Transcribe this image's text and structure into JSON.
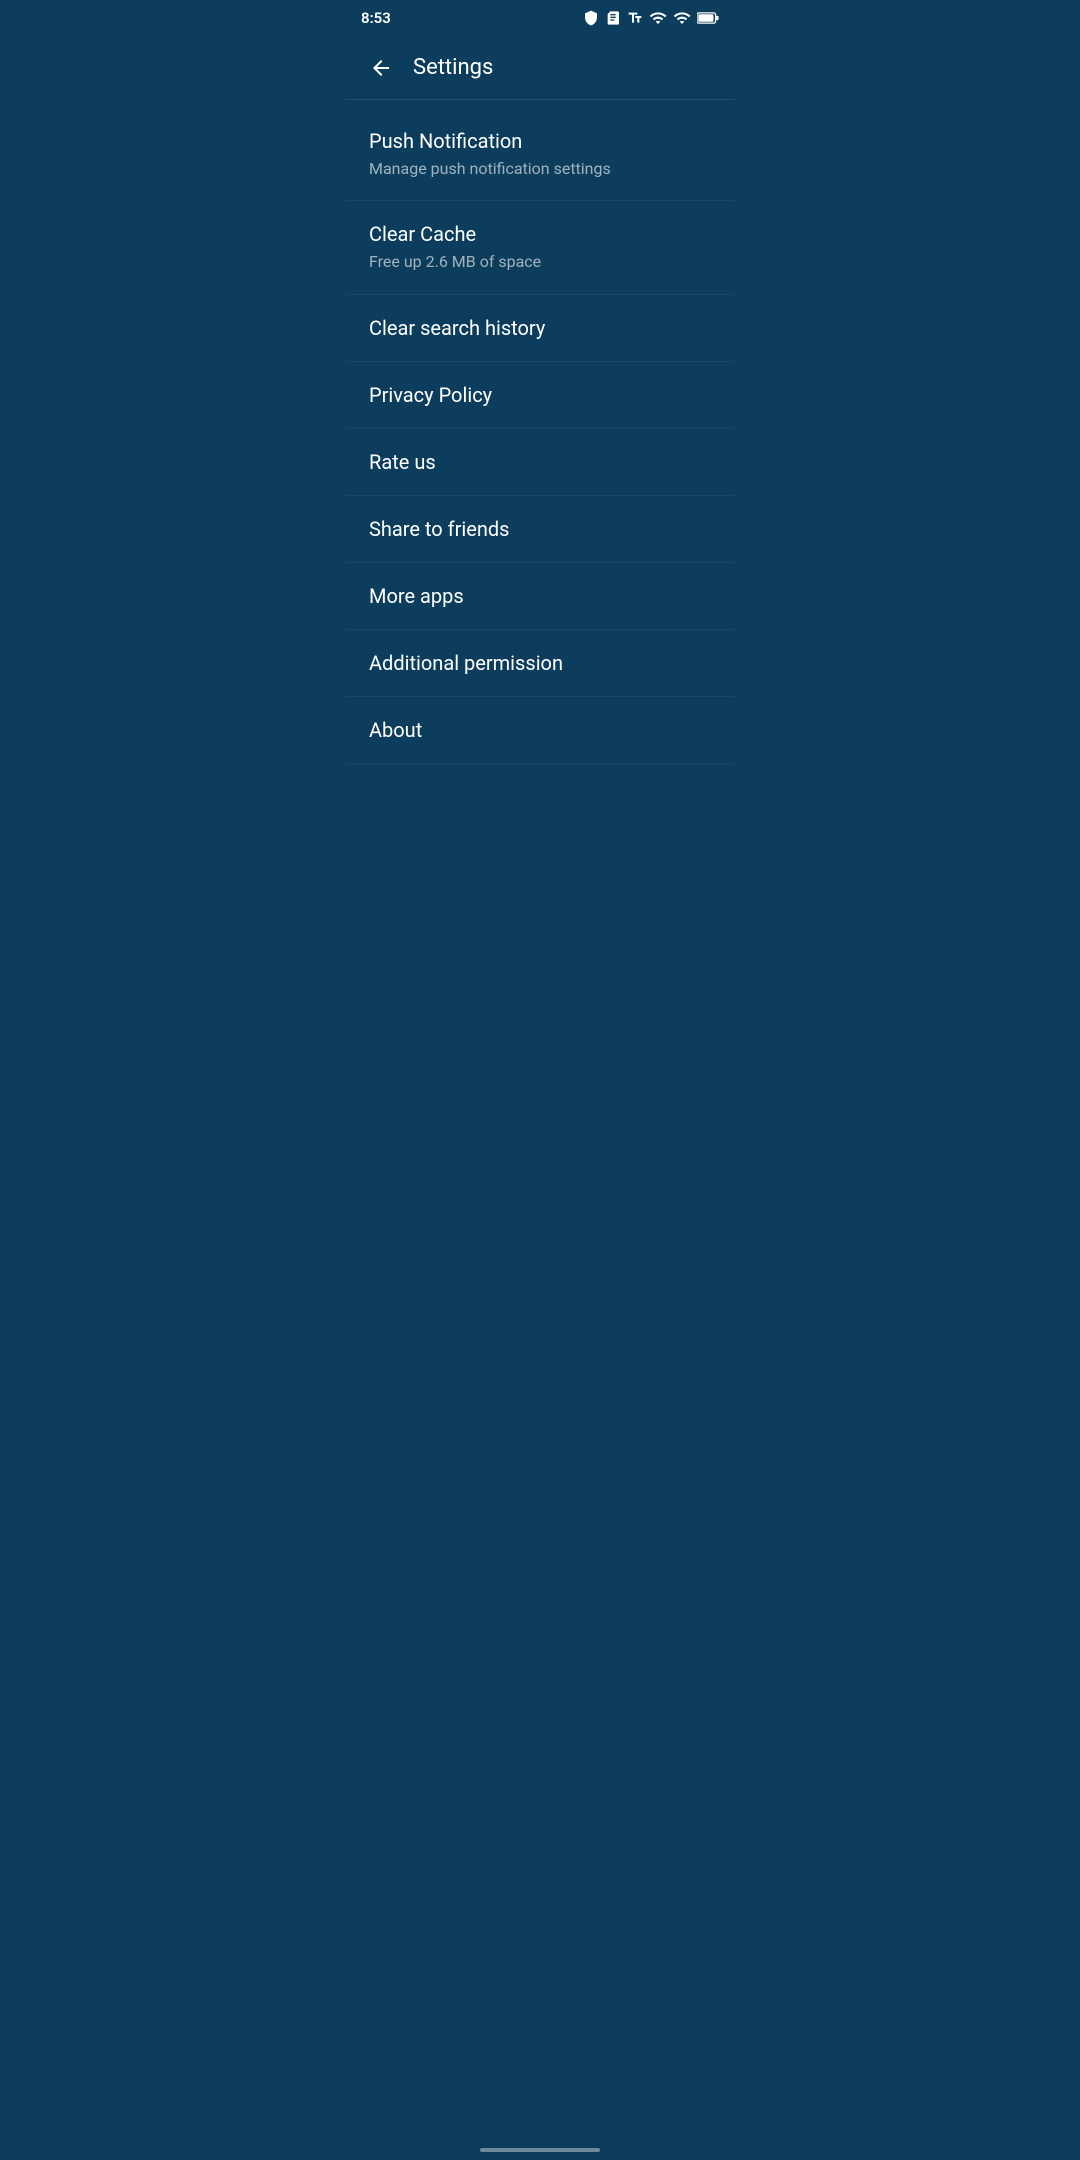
{
  "statusBar": {
    "time": "8:53",
    "icons": [
      "shield",
      "sim-card",
      "text-format",
      "wifi",
      "signal",
      "battery"
    ]
  },
  "toolbar": {
    "title": "Settings",
    "backLabel": "back"
  },
  "settingsItems": [
    {
      "id": "push-notification",
      "title": "Push Notification",
      "subtitle": "Manage push notification settings",
      "hasSubtitle": true
    },
    {
      "id": "clear-cache",
      "title": "Clear Cache",
      "subtitle": "Free up 2.6 MB of space",
      "hasSubtitle": true
    },
    {
      "id": "clear-search-history",
      "title": "Clear search history",
      "subtitle": null,
      "hasSubtitle": false
    },
    {
      "id": "privacy-policy",
      "title": "Privacy Policy",
      "subtitle": null,
      "hasSubtitle": false
    },
    {
      "id": "rate-us",
      "title": "Rate us",
      "subtitle": null,
      "hasSubtitle": false
    },
    {
      "id": "share-to-friends",
      "title": "Share to friends",
      "subtitle": null,
      "hasSubtitle": false
    },
    {
      "id": "more-apps",
      "title": "More apps",
      "subtitle": null,
      "hasSubtitle": false
    },
    {
      "id": "additional-permission",
      "title": "Additional permission",
      "subtitle": null,
      "hasSubtitle": false
    },
    {
      "id": "about",
      "title": "About",
      "subtitle": null,
      "hasSubtitle": false
    }
  ]
}
